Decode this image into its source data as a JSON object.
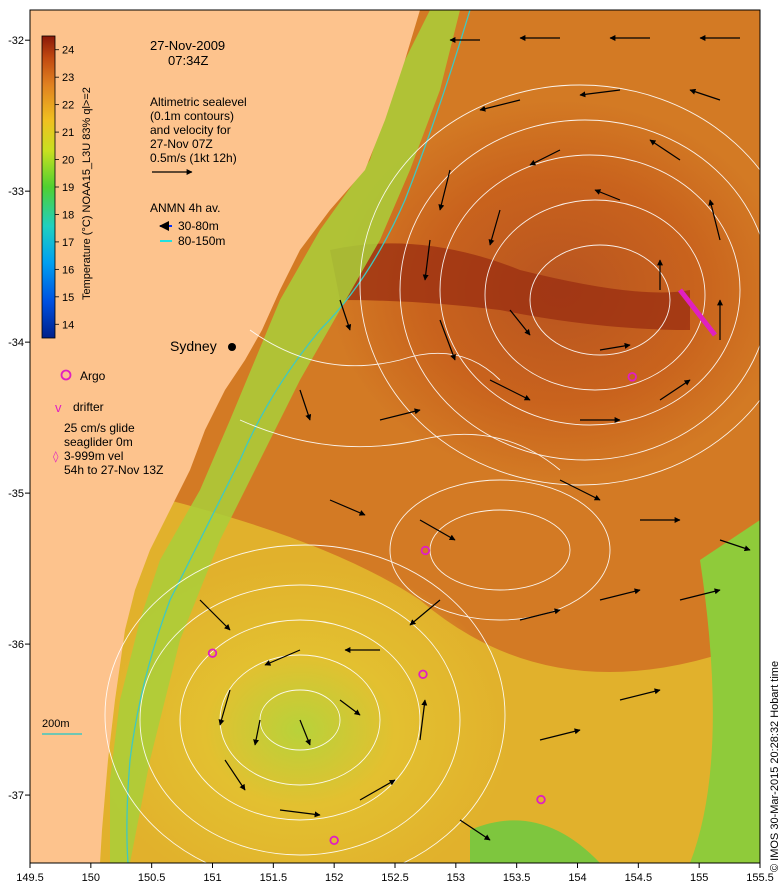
{
  "map": {
    "date": "27-Nov-2009",
    "time": "07:34Z",
    "altimetry_note": [
      "Altimetric sealevel",
      "(0.1m contours)",
      "and velocity for",
      "27-Nov 07Z",
      "0.5m/s (1kt 12h)"
    ],
    "anmn_title": "ANMN 4h av.",
    "anmn_shallow": "30-80m",
    "anmn_deep": "80-150m",
    "place_label": "Sydney",
    "argo_label": "Argo",
    "drifter_label": "drifter",
    "glider_note": [
      "25 cm/s glide",
      "seaglider 0m",
      "3-999m vel",
      "54h to 27-Nov 13Z"
    ],
    "isobath_label": "200m",
    "credit": "© IMOS 30-Mar-2015 20:28:32 Hobart time",
    "colorbar_label": "Temperature (°C) NOAA15_L3U 83% ql>=2",
    "colorbar_ticks": [
      "14",
      "15",
      "16",
      "17",
      "18",
      "19",
      "20",
      "21",
      "22",
      "23",
      "24"
    ],
    "lon_ticks": [
      "149.5",
      "150",
      "150.5",
      "151",
      "151.5",
      "152",
      "152.5",
      "153",
      "153.5",
      "154",
      "154.5",
      "155",
      "155.5"
    ],
    "lat_ticks": [
      "-32",
      "-33",
      "-34",
      "-35",
      "-36",
      "-37"
    ],
    "lon_range": [
      149.5,
      155.5
    ],
    "lat_range": [
      -37.45,
      -31.8
    ],
    "colors": {
      "land": "#fdc38d",
      "sst_warm": "#9a2e12",
      "sst_mid": "#d57a22",
      "sst_cool": "#e8b52a",
      "sst_cold": "#a8d02e",
      "contour": "#ffffff",
      "arrow": "#000000",
      "argo": "#e020c0",
      "isobath": "#40c8c0",
      "anmn_shallow": "#0030ff",
      "anmn_deep": "#20e0e0"
    },
    "argo_floats": [
      {
        "lon": 152.75,
        "lat": -35.38
      },
      {
        "lon": 151.0,
        "lat": -36.06
      },
      {
        "lon": 152.73,
        "lat": -36.2
      },
      {
        "lon": 153.7,
        "lat": -37.03
      },
      {
        "lon": 152.0,
        "lat": -37.3
      },
      {
        "lon": 154.45,
        "lat": -34.23
      }
    ]
  }
}
